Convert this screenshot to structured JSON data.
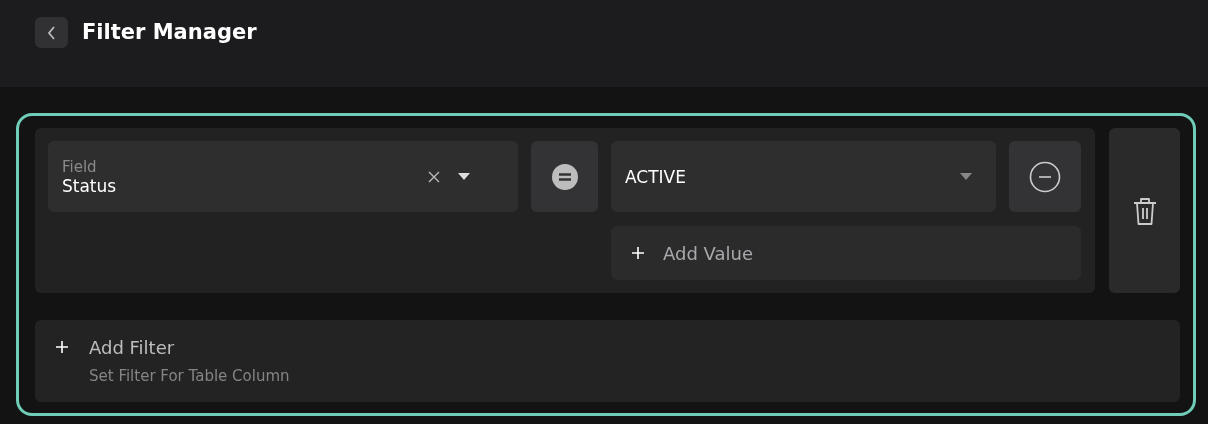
{
  "header": {
    "title": "Filter Manager"
  },
  "filters": [
    {
      "field": {
        "label": "Field",
        "value": "Status"
      },
      "values": [
        "ACTIVE"
      ],
      "add_value": "Add Value"
    }
  ],
  "add_filter": {
    "label": "Add Filter",
    "hint": "Set Filter For Table Column"
  }
}
